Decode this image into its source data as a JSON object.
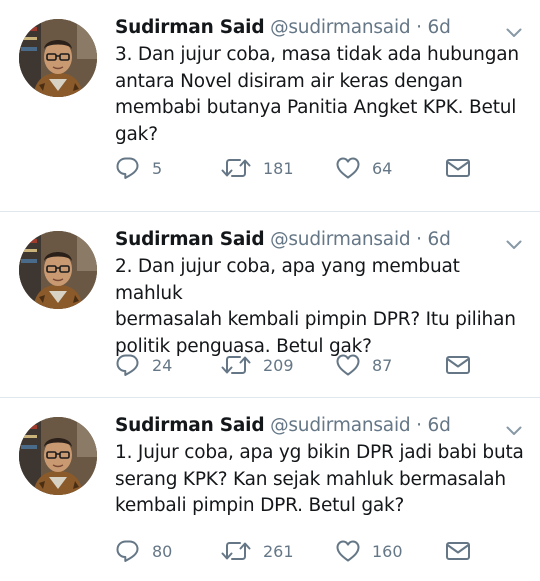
{
  "tweets": [
    {
      "name": "Sudirman Said",
      "handle": "@sudirmansaid",
      "separator": "·",
      "time": "6d",
      "text": "3. Dan jujur coba, masa tidak ada hubungan\nantara Novel disiram air keras dengan\nmembabi butanya Panitia Angket KPK. Betul\ngak?",
      "replies": "5",
      "retweets": "181",
      "likes": "64"
    },
    {
      "name": "Sudirman Said",
      "handle": "@sudirmansaid",
      "separator": "·",
      "time": "6d",
      "text": "2. Dan jujur coba, apa yang membuat mahluk\nbermasalah kembali pimpin DPR?  Itu pilihan\npolitik penguasa. Betul gak?",
      "replies": "24",
      "retweets": "209",
      "likes": "87"
    },
    {
      "name": "Sudirman Said",
      "handle": "@sudirmansaid",
      "separator": "·",
      "time": "6d",
      "text": "1. Jujur coba, apa yg bikin DPR jadi babi buta\nserang KPK?  Kan sejak mahluk bermasalah\nkembali pimpin DPR.  Betul gak?",
      "replies": "80",
      "retweets": "261",
      "likes": "160"
    }
  ],
  "icons": {
    "reply": "reply-icon",
    "retweet": "retweet-icon",
    "like": "heart-icon",
    "message": "envelope-icon",
    "caret": "chevron-down-icon"
  },
  "colors": {
    "text": "#14171a",
    "secondary": "#657786",
    "divider": "#e1e8ed"
  }
}
